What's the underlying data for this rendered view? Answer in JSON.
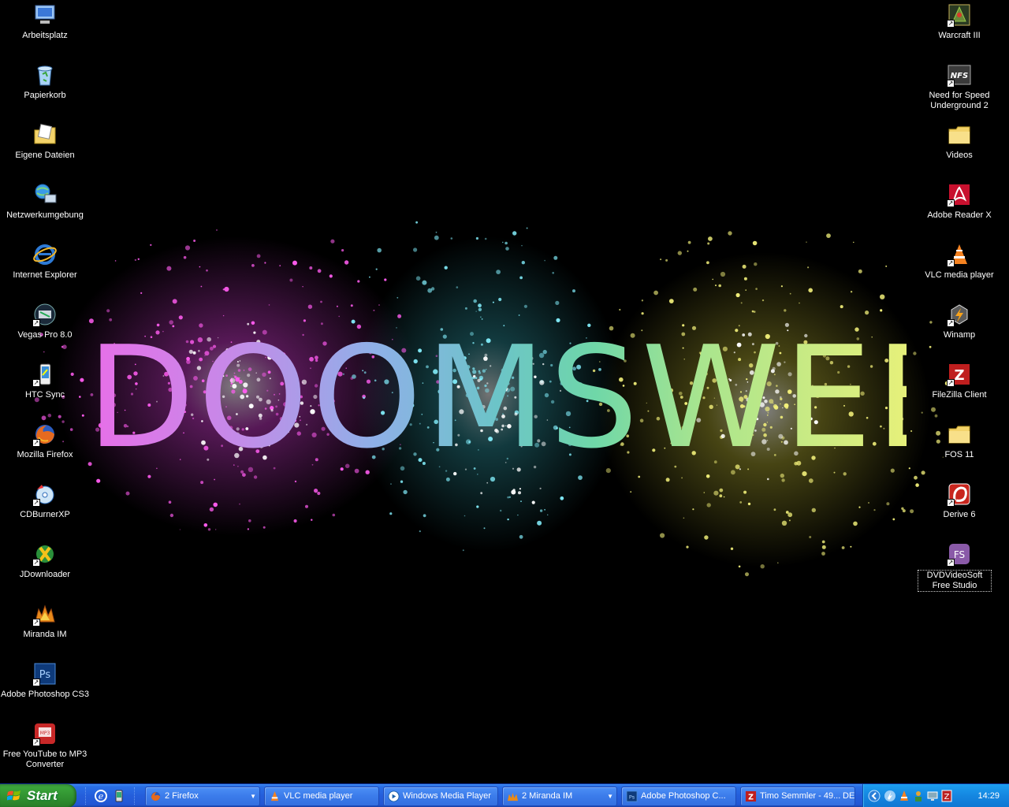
{
  "wallpaper": {
    "text": "DOOMSWEB"
  },
  "desktop_left": [
    {
      "name": "computer",
      "label": "Arbeitsplatz"
    },
    {
      "name": "recycle-bin",
      "label": "Papierkorb"
    },
    {
      "name": "my-documents",
      "label": "Eigene Dateien"
    },
    {
      "name": "network",
      "label": "Netzwerkumgebung"
    },
    {
      "name": "internet-explorer",
      "label": "Internet Explorer"
    },
    {
      "name": "vegas-pro",
      "label": "Vegas Pro 8.0"
    },
    {
      "name": "htc-sync",
      "label": "HTC Sync"
    },
    {
      "name": "firefox",
      "label": "Mozilla Firefox"
    },
    {
      "name": "cdburnerxp",
      "label": "CDBurnerXP"
    },
    {
      "name": "jdownloader",
      "label": "JDownloader"
    },
    {
      "name": "miranda",
      "label": "Miranda IM"
    },
    {
      "name": "photoshop",
      "label": "Adobe Photoshop CS3"
    },
    {
      "name": "youtube-mp3",
      "label": "Free YouTube to MP3 Converter"
    }
  ],
  "desktop_right": [
    {
      "name": "warcraft",
      "label": "Warcraft III"
    },
    {
      "name": "nfs",
      "label": "Need for Speed Underground 2"
    },
    {
      "name": "videos",
      "label": "Videos"
    },
    {
      "name": "adobe-reader",
      "label": "Adobe Reader X"
    },
    {
      "name": "vlc",
      "label": "VLC media player"
    },
    {
      "name": "winamp",
      "label": "Winamp"
    },
    {
      "name": "filezilla",
      "label": "FileZilla Client"
    },
    {
      "name": "fos",
      "label": "FOS 11"
    },
    {
      "name": "derive",
      "label": "Derive 6"
    },
    {
      "name": "dvdvideosoft",
      "label": "DVDVideoSoft Free Studio"
    }
  ],
  "taskbar": {
    "start_label": "Start",
    "tasks": [
      {
        "name": "firefox",
        "label": "2 Firefox"
      },
      {
        "name": "vlc",
        "label": "VLC media player"
      },
      {
        "name": "wmp",
        "label": "Windows Media Player"
      },
      {
        "name": "miranda",
        "label": "2 Miranda IM"
      },
      {
        "name": "photoshop",
        "label": "Adobe Photoshop C..."
      },
      {
        "name": "filezilla",
        "label": "Timo Semmler - 49..."
      }
    ],
    "language": "DE",
    "clock": "14:29"
  },
  "colors": {
    "taskbar": "#245edb",
    "start": "#3aa53a",
    "tray": "#1486e0"
  }
}
